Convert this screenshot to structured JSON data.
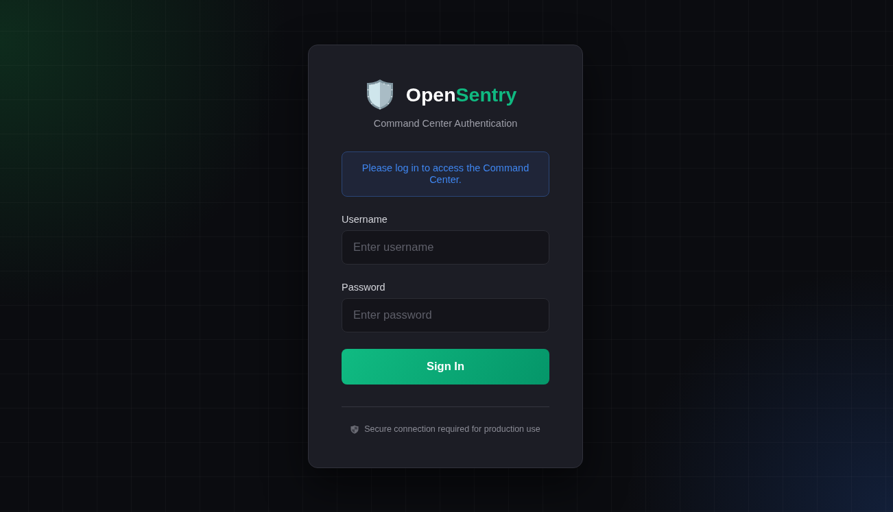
{
  "brand": {
    "name_parts": [
      {
        "text": "Open",
        "kind": "plain"
      },
      {
        "text": "Sentry",
        "kind": "accent"
      }
    ],
    "subtitle": "Command Center Authentication"
  },
  "notice": {
    "text": "Please log in to access the Command Center.",
    "kind": "info"
  },
  "fields": [
    {
      "label": "Username",
      "placeholder": "Enter username"
    },
    {
      "label": "Password",
      "placeholder": "Enter password"
    }
  ],
  "submit": {
    "label": "Sign In"
  },
  "footer": {
    "text": "Secure connection required for production use"
  }
}
